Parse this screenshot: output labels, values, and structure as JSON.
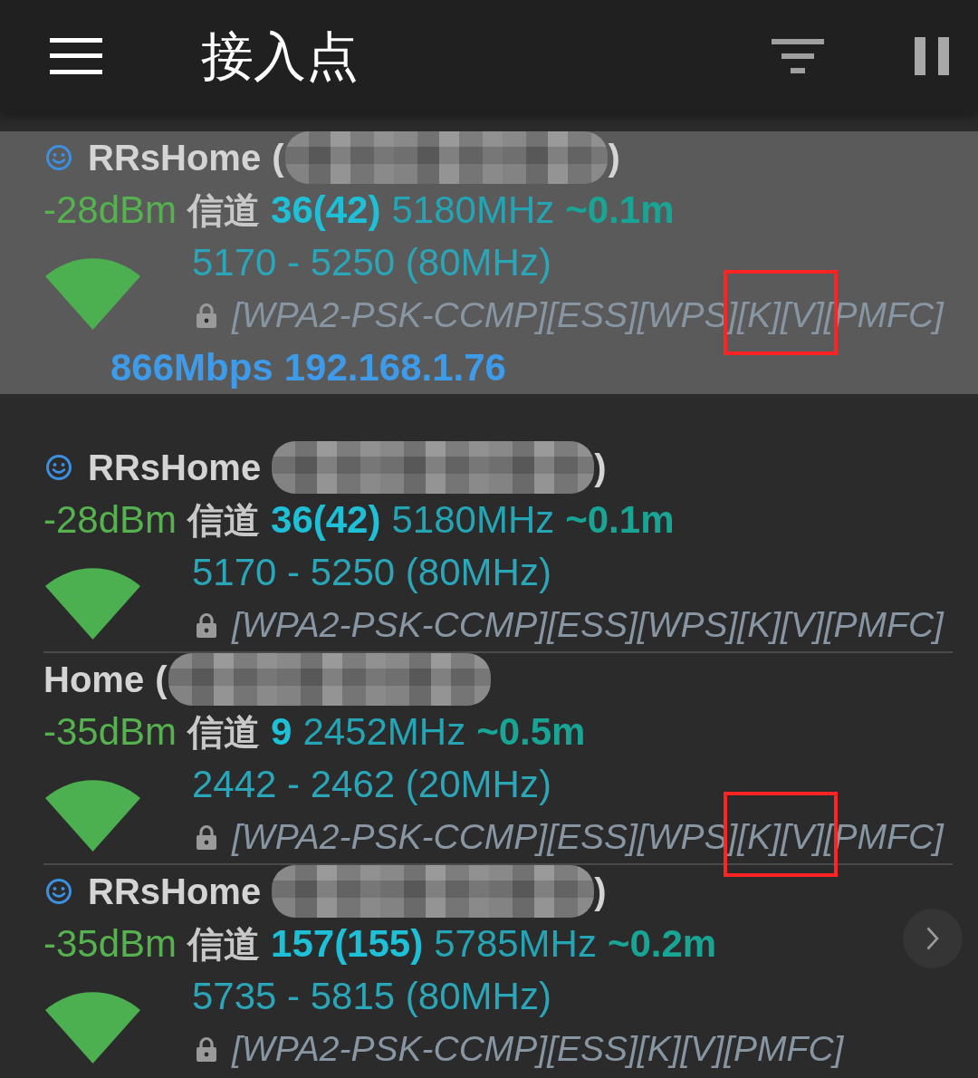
{
  "app_bar": {
    "title": "接入点"
  },
  "connected_network": {
    "saved": true,
    "ssid": "RRsHome",
    "bssid_open": "(",
    "bssid_close": ")",
    "signal": "-28dBm",
    "channel_label": "信道",
    "channel": "36(42)",
    "frequency": "5180MHz",
    "distance": "~0.1m",
    "range": "5170 - 5250 (80MHz)",
    "security": "[WPA2-PSK-CCMP][ESS][WPS][K][V][PMFC]",
    "marked": true,
    "link_speed": "866Mbps",
    "ip": "192.168.1.76"
  },
  "networks": [
    {
      "saved": true,
      "ssid": "RRsHome",
      "bssid_close": ")",
      "signal": "-28dBm",
      "channel_label": "信道",
      "channel": "36(42)",
      "frequency": "5180MHz",
      "distance": "~0.1m",
      "range": "5170 - 5250 (80MHz)",
      "security": "[WPA2-PSK-CCMP][ESS][WPS][K][V][PMFC]",
      "marked": false
    },
    {
      "saved": false,
      "ssid": "Home",
      "bssid_open": "(",
      "signal": "-35dBm",
      "channel_label": "信道",
      "channel": "9",
      "frequency": "2452MHz",
      "distance": "~0.5m",
      "range": "2442 - 2462 (20MHz)",
      "security": "[WPA2-PSK-CCMP][ESS][WPS][K][V][PMFC]",
      "marked": true
    },
    {
      "saved": true,
      "ssid": "RRsHome",
      "bssid_close": ")",
      "signal": "-35dBm",
      "channel_label": "信道",
      "channel": "157(155)",
      "frequency": "5785MHz",
      "distance": "~0.2m",
      "range": "5735 - 5815 (80MHz)",
      "security": "[WPA2-PSK-CCMP][ESS][K][V][PMFC]",
      "marked": false
    }
  ]
}
